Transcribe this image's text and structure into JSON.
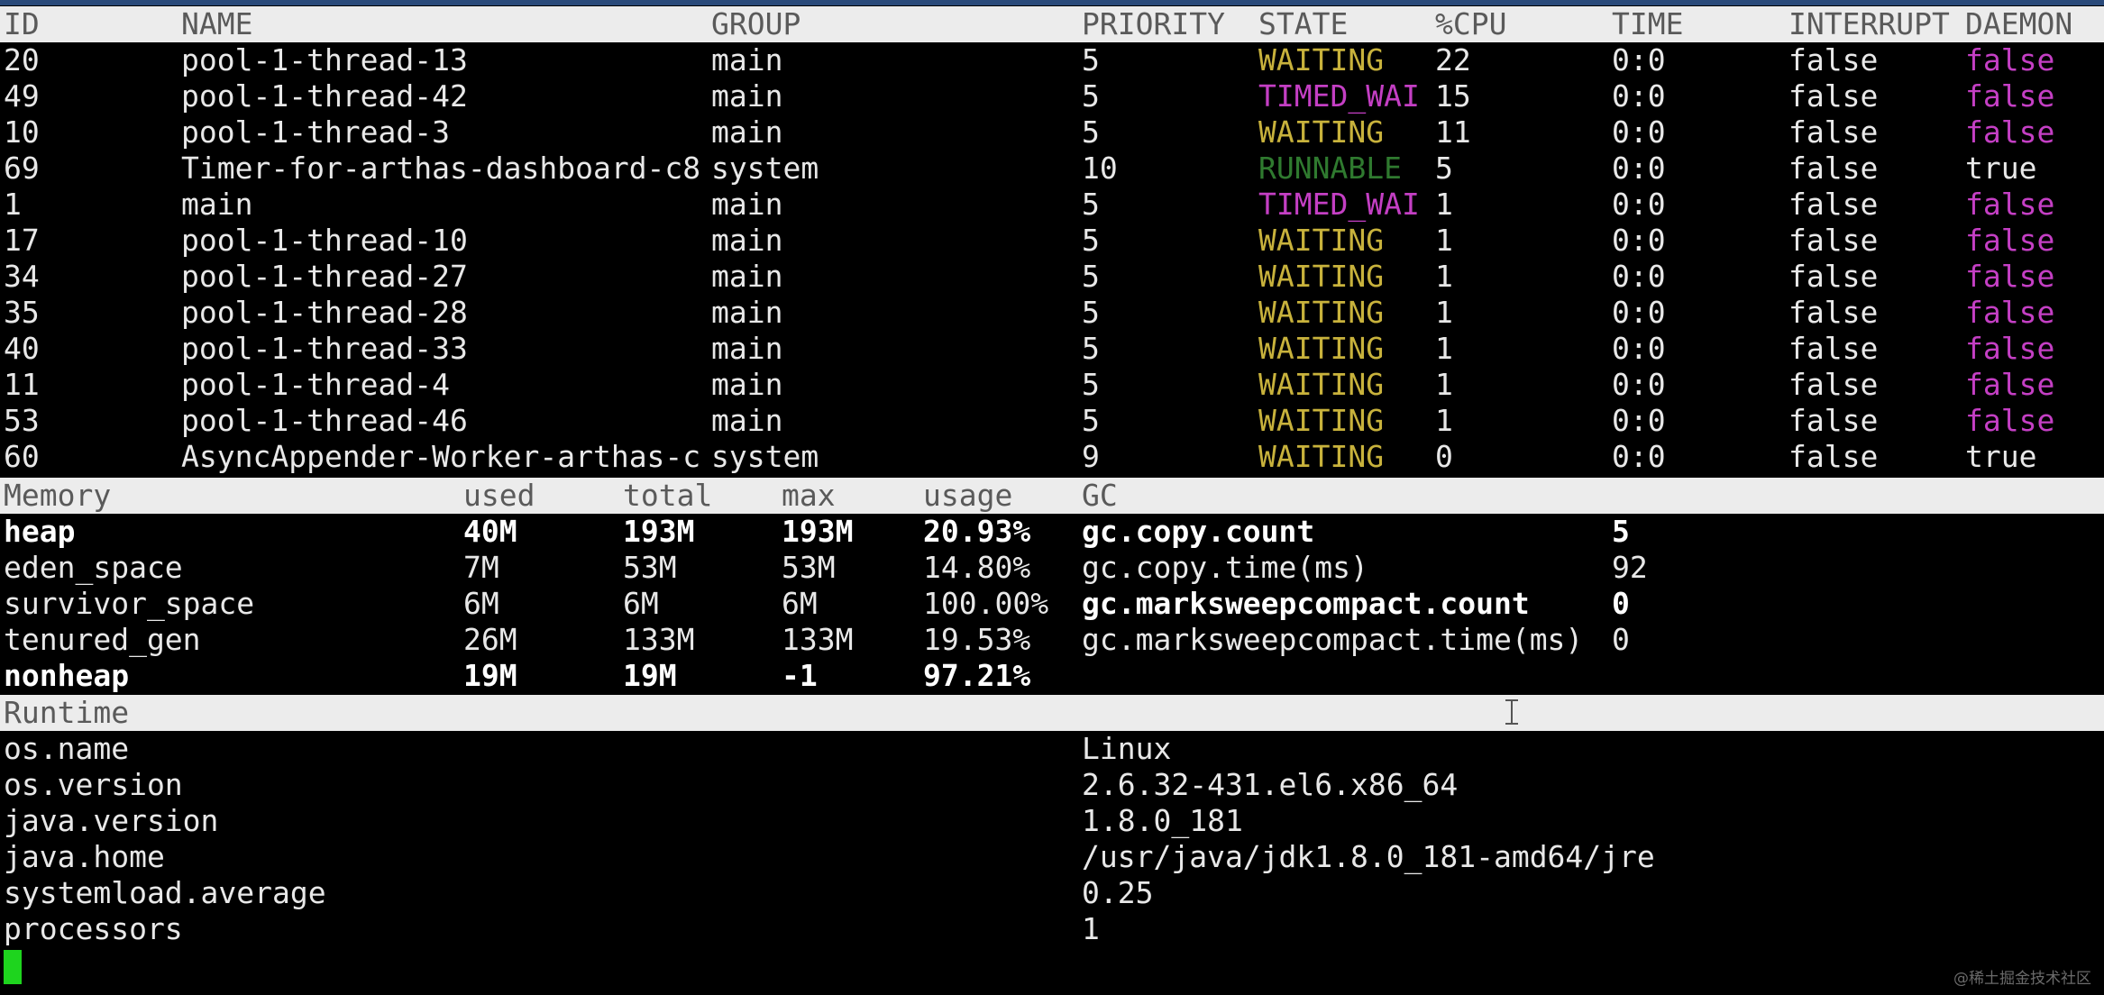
{
  "thread_table": {
    "headers": {
      "id": "ID",
      "name": "NAME",
      "group": "GROUP",
      "priority": "PRIORITY",
      "state": "STATE",
      "cpu": "%CPU",
      "time": "TIME",
      "interrupt": "INTERRUPT",
      "daemon": "DAEMON"
    },
    "rows": [
      {
        "id": "20",
        "name": "pool-1-thread-13",
        "group": "main",
        "priority": "5",
        "state": "WAITING",
        "cpu": "22",
        "time": "0:0",
        "interrupt": "false",
        "daemon": "false"
      },
      {
        "id": "49",
        "name": "pool-1-thread-42",
        "group": "main",
        "priority": "5",
        "state": "TIMED_WAI",
        "cpu": "15",
        "time": "0:0",
        "interrupt": "false",
        "daemon": "false"
      },
      {
        "id": "10",
        "name": "pool-1-thread-3",
        "group": "main",
        "priority": "5",
        "state": "WAITING",
        "cpu": "11",
        "time": "0:0",
        "interrupt": "false",
        "daemon": "false"
      },
      {
        "id": "69",
        "name": "Timer-for-arthas-dashboard-c8",
        "group": "system",
        "priority": "10",
        "state": "RUNNABLE",
        "cpu": "5",
        "time": "0:0",
        "interrupt": "false",
        "daemon": "true"
      },
      {
        "id": "1",
        "name": "main",
        "group": "main",
        "priority": "5",
        "state": "TIMED_WAI",
        "cpu": "1",
        "time": "0:0",
        "interrupt": "false",
        "daemon": "false"
      },
      {
        "id": "17",
        "name": "pool-1-thread-10",
        "group": "main",
        "priority": "5",
        "state": "WAITING",
        "cpu": "1",
        "time": "0:0",
        "interrupt": "false",
        "daemon": "false"
      },
      {
        "id": "34",
        "name": "pool-1-thread-27",
        "group": "main",
        "priority": "5",
        "state": "WAITING",
        "cpu": "1",
        "time": "0:0",
        "interrupt": "false",
        "daemon": "false"
      },
      {
        "id": "35",
        "name": "pool-1-thread-28",
        "group": "main",
        "priority": "5",
        "state": "WAITING",
        "cpu": "1",
        "time": "0:0",
        "interrupt": "false",
        "daemon": "false"
      },
      {
        "id": "40",
        "name": "pool-1-thread-33",
        "group": "main",
        "priority": "5",
        "state": "WAITING",
        "cpu": "1",
        "time": "0:0",
        "interrupt": "false",
        "daemon": "false"
      },
      {
        "id": "11",
        "name": "pool-1-thread-4",
        "group": "main",
        "priority": "5",
        "state": "WAITING",
        "cpu": "1",
        "time": "0:0",
        "interrupt": "false",
        "daemon": "false"
      },
      {
        "id": "53",
        "name": "pool-1-thread-46",
        "group": "main",
        "priority": "5",
        "state": "WAITING",
        "cpu": "1",
        "time": "0:0",
        "interrupt": "false",
        "daemon": "false"
      },
      {
        "id": "60",
        "name": "AsyncAppender-Worker-arthas-c",
        "group": "system",
        "priority": "9",
        "state": "WAITING",
        "cpu": "0",
        "time": "0:0",
        "interrupt": "false",
        "daemon": "true"
      }
    ]
  },
  "memory": {
    "headers": {
      "memory": "Memory",
      "used": "used",
      "total": "total",
      "max": "max",
      "usage": "usage",
      "gc": "GC"
    },
    "rows": [
      {
        "name": "heap",
        "used": "40M",
        "total": "193M",
        "max": "193M",
        "usage": "20.93%",
        "gc_name": "gc.copy.count",
        "gc_value": "5",
        "bold": true,
        "gc_bold": true
      },
      {
        "name": "eden_space",
        "used": "7M",
        "total": "53M",
        "max": "53M",
        "usage": "14.80%",
        "gc_name": "gc.copy.time(ms)",
        "gc_value": "92",
        "bold": false,
        "gc_bold": false
      },
      {
        "name": "survivor_space",
        "used": "6M",
        "total": "6M",
        "max": "6M",
        "usage": "100.00%",
        "gc_name": "gc.marksweepcompact.count",
        "gc_value": "0",
        "bold": false,
        "gc_bold": true
      },
      {
        "name": "tenured_gen",
        "used": "26M",
        "total": "133M",
        "max": "133M",
        "usage": "19.53%",
        "gc_name": "gc.marksweepcompact.time(ms)",
        "gc_value": "0",
        "bold": false,
        "gc_bold": false
      },
      {
        "name": "nonheap",
        "used": "19M",
        "total": "19M",
        "max": "-1",
        "usage": "97.21%",
        "gc_name": "",
        "gc_value": "",
        "bold": true,
        "gc_bold": false
      }
    ]
  },
  "runtime": {
    "header": "Runtime",
    "rows": [
      {
        "key": "os.name",
        "value": "Linux"
      },
      {
        "key": "os.version",
        "value": "2.6.32-431.el6.x86_64"
      },
      {
        "key": "java.version",
        "value": "1.8.0_181"
      },
      {
        "key": "java.home",
        "value": "/usr/java/jdk1.8.0_181-amd64/jre"
      },
      {
        "key": "systemload.average",
        "value": "0.25"
      },
      {
        "key": "processors",
        "value": "1"
      }
    ]
  },
  "colors": {
    "waiting": "#c8b23c",
    "timed_waiting": "#c43fc4",
    "runnable": "#2f7a2f",
    "daemon_false": "#c43fc4",
    "header_bg": "#ececec",
    "cursor": "#1ed41e"
  },
  "watermark": "@稀土掘金技术社区"
}
